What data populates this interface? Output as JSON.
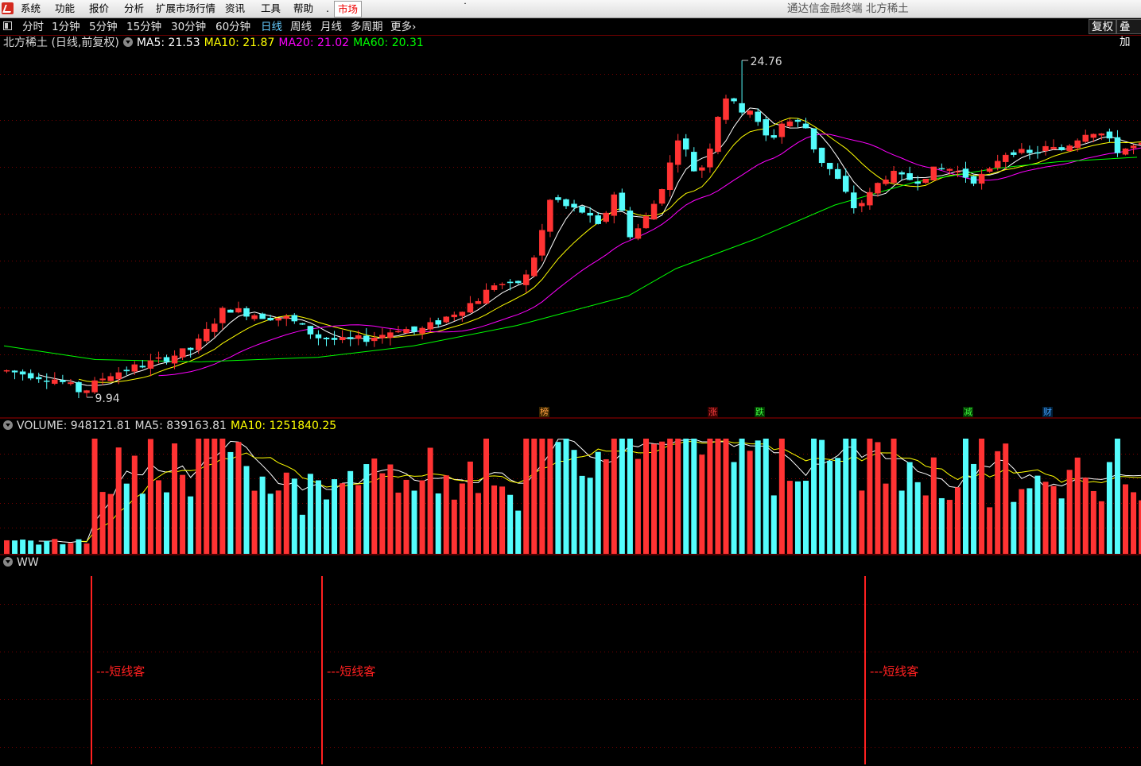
{
  "menu": {
    "items": [
      "系统",
      "功能",
      "报价",
      "分析",
      "扩展市场行情",
      "资讯",
      "工具",
      "帮助"
    ],
    "dot": ".",
    "market_tab": "市场",
    "mini_dot": "˙",
    "app_title": "通达信金融终端  北方稀土"
  },
  "periods": {
    "items": [
      "分时",
      "1分钟",
      "5分钟",
      "15分钟",
      "30分钟",
      "60分钟",
      "日线",
      "周线",
      "月线",
      "多周期",
      "更多›"
    ],
    "active": "日线",
    "right_buttons": [
      "复权",
      "叠加"
    ]
  },
  "price_panel": {
    "title": "北方稀土 (日线,前复权)",
    "ma5": "MA5: 21.53",
    "ma10": "MA10: 21.87",
    "ma20": "MA20: 21.02",
    "ma60": "MA60: 20.31",
    "high_label": "24.76",
    "low_label": "9.94",
    "markers": [
      {
        "text": "榜",
        "color": "#ff9f40"
      },
      {
        "text": "涨",
        "color": "#ff4040"
      },
      {
        "text": "跌",
        "color": "#40ff40"
      },
      {
        "text": "减",
        "color": "#40ff40"
      },
      {
        "text": "财",
        "color": "#40a0ff"
      }
    ]
  },
  "volume_panel": {
    "title": "VOLUME: 948121.81",
    "ma5": "MA5: 839163.81",
    "ma10": "MA10: 1251840.25"
  },
  "ww_panel": {
    "title": "WW",
    "signal_label": "---短线客"
  },
  "colors": {
    "up": "#ff3333",
    "down": "#54fcfc",
    "ma5": "#ffffff",
    "ma10": "#ffff00",
    "ma20": "#ff00ff",
    "ma60": "#00ff00",
    "grid": "#7a0000"
  },
  "chart_data": {
    "type": "candlestick",
    "price_high": 24.76,
    "price_low": 9.94,
    "series": [
      {
        "name": "MA5",
        "value": 21.53
      },
      {
        "name": "MA10",
        "value": 21.87
      },
      {
        "name": "MA20",
        "value": 21.02
      },
      {
        "name": "MA60",
        "value": 20.31
      }
    ],
    "volume": {
      "value": 948121.81,
      "ma5": 839163.81,
      "ma10": 1251840.25
    },
    "signals": {
      "label": "---短线客",
      "count": 3
    }
  }
}
